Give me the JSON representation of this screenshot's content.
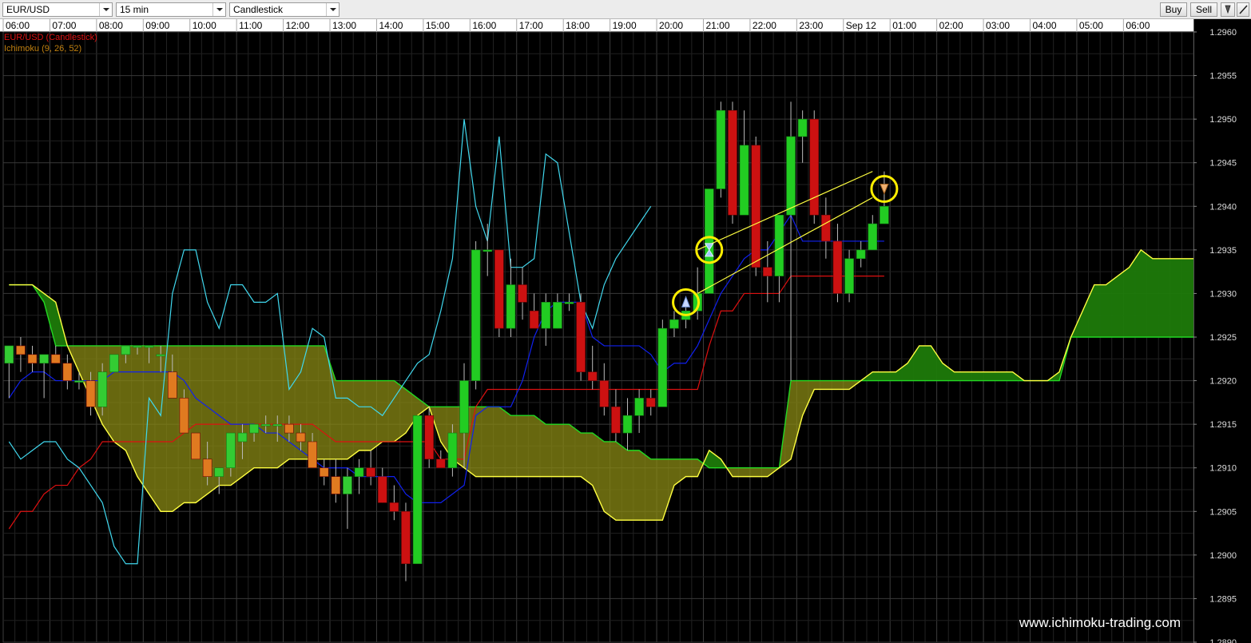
{
  "toolbar": {
    "symbol": "EUR/USD",
    "timeframe": "15 min",
    "chart_type": "Candlestick",
    "buy_label": "Buy",
    "sell_label": "Sell",
    "icon_arrow": "arrow-down-icon",
    "icon_pencil": "pencil-icon"
  },
  "legend": {
    "series": "EUR/USD (Candlestick)",
    "indicator": "Ichimoku (9, 26, 52)"
  },
  "watermark": "www.ichimoku-trading.com",
  "colors": {
    "background": "#000000",
    "grid": "#2c2c2c",
    "candle_up": "#22cc22",
    "candle_down": "#cc1111",
    "candle_up_cloud": "#33cc33",
    "candle_down_cloud": "#e07a20",
    "tenkan": "#1020ee",
    "kijun": "#dd1010",
    "chikou": "#40d8ee",
    "senkou_a": "#ffff40",
    "senkou_b": "#22d822",
    "cloud_bull": "#1d7a0a",
    "cloud_bear": "#8a8a14",
    "channel": "#ffff40",
    "signal_circle": "#ffee00",
    "label_series": "#dd1111",
    "label_indicator": "#c08010"
  },
  "chart_data": {
    "type": "candlestick",
    "interval": "15 min",
    "ylim": [
      1.289,
      1.296
    ],
    "y_ticks": [
      "1.2890",
      "1.2895",
      "1.2900",
      "1.2905",
      "1.2910",
      "1.2915",
      "1.2920",
      "1.2925",
      "1.2930",
      "1.2935",
      "1.2940",
      "1.2945",
      "1.2950",
      "1.2955",
      "1.2960"
    ],
    "x_ticks": [
      "06:00",
      "07:00",
      "08:00",
      "09:00",
      "10:00",
      "11:00",
      "12:00",
      "13:00",
      "14:00",
      "15:00",
      "16:00",
      "17:00",
      "18:00",
      "19:00",
      "20:00",
      "21:00",
      "22:00",
      "23:00",
      "Sep 12",
      "01:00",
      "02:00",
      "03:00",
      "04:00",
      "05:00",
      "06:00"
    ],
    "candles": [
      {
        "t": "06:00",
        "o": 1.2922,
        "h": 1.2924,
        "l": 1.2918,
        "c": 1.2924
      },
      {
        "t": "06:15",
        "o": 1.2924,
        "h": 1.2925,
        "l": 1.2921,
        "c": 1.2923
      },
      {
        "t": "06:30",
        "o": 1.2923,
        "h": 1.2924,
        "l": 1.2921,
        "c": 1.2922
      },
      {
        "t": "06:45",
        "o": 1.2922,
        "h": 1.2923,
        "l": 1.2918,
        "c": 1.2923
      },
      {
        "t": "07:00",
        "o": 1.2923,
        "h": 1.2924,
        "l": 1.2922,
        "c": 1.2922
      },
      {
        "t": "07:15",
        "o": 1.2922,
        "h": 1.2923,
        "l": 1.2919,
        "c": 1.292
      },
      {
        "t": "07:30",
        "o": 1.292,
        "h": 1.2921,
        "l": 1.2919,
        "c": 1.292
      },
      {
        "t": "07:45",
        "o": 1.292,
        "h": 1.2921,
        "l": 1.2916,
        "c": 1.2917
      },
      {
        "t": "08:00",
        "o": 1.2917,
        "h": 1.2922,
        "l": 1.2916,
        "c": 1.2921
      },
      {
        "t": "08:15",
        "o": 1.2921,
        "h": 1.2923,
        "l": 1.2921,
        "c": 1.2923
      },
      {
        "t": "08:30",
        "o": 1.2923,
        "h": 1.2924,
        "l": 1.2922,
        "c": 1.2924
      },
      {
        "t": "08:45",
        "o": 1.2924,
        "h": 1.2924,
        "l": 1.2923,
        "c": 1.2924
      },
      {
        "t": "09:00",
        "o": 1.2924,
        "h": 1.2924,
        "l": 1.2922,
        "c": 1.2924
      },
      {
        "t": "09:15",
        "o": 1.2923,
        "h": 1.2924,
        "l": 1.2921,
        "c": 1.2923
      },
      {
        "t": "09:30",
        "o": 1.2921,
        "h": 1.2923,
        "l": 1.2918,
        "c": 1.2918
      },
      {
        "t": "09:45",
        "o": 1.2918,
        "h": 1.2919,
        "l": 1.2914,
        "c": 1.2914
      },
      {
        "t": "10:00",
        "o": 1.2914,
        "h": 1.2914,
        "l": 1.2911,
        "c": 1.2911
      },
      {
        "t": "10:15",
        "o": 1.2911,
        "h": 1.2913,
        "l": 1.2908,
        "c": 1.2909
      },
      {
        "t": "10:30",
        "o": 1.2909,
        "h": 1.291,
        "l": 1.2907,
        "c": 1.291
      },
      {
        "t": "10:45",
        "o": 1.291,
        "h": 1.2914,
        "l": 1.2909,
        "c": 1.2914
      },
      {
        "t": "11:00",
        "o": 1.2913,
        "h": 1.2915,
        "l": 1.2911,
        "c": 1.2914
      },
      {
        "t": "11:15",
        "o": 1.2914,
        "h": 1.2915,
        "l": 1.2913,
        "c": 1.2915
      },
      {
        "t": "11:30",
        "o": 1.2915,
        "h": 1.2916,
        "l": 1.2914,
        "c": 1.2915
      },
      {
        "t": "11:45",
        "o": 1.2915,
        "h": 1.2916,
        "l": 1.2913,
        "c": 1.2915
      },
      {
        "t": "12:00",
        "o": 1.2915,
        "h": 1.2916,
        "l": 1.2913,
        "c": 1.2914
      },
      {
        "t": "12:15",
        "o": 1.2914,
        "h": 1.2915,
        "l": 1.2912,
        "c": 1.2913
      },
      {
        "t": "12:30",
        "o": 1.2913,
        "h": 1.2914,
        "l": 1.291,
        "c": 1.291
      },
      {
        "t": "12:45",
        "o": 1.291,
        "h": 1.2911,
        "l": 1.2908,
        "c": 1.2909
      },
      {
        "t": "13:00",
        "o": 1.2909,
        "h": 1.2911,
        "l": 1.2906,
        "c": 1.2907
      },
      {
        "t": "13:15",
        "o": 1.2907,
        "h": 1.291,
        "l": 1.2903,
        "c": 1.2909
      },
      {
        "t": "13:30",
        "o": 1.2909,
        "h": 1.2911,
        "l": 1.2907,
        "c": 1.291
      },
      {
        "t": "13:45",
        "o": 1.291,
        "h": 1.2912,
        "l": 1.2908,
        "c": 1.2909
      },
      {
        "t": "14:00",
        "o": 1.2909,
        "h": 1.291,
        "l": 1.2906,
        "c": 1.2906
      },
      {
        "t": "14:15",
        "o": 1.2906,
        "h": 1.2908,
        "l": 1.2904,
        "c": 1.2905
      },
      {
        "t": "14:30",
        "o": 1.2905,
        "h": 1.2906,
        "l": 1.2897,
        "c": 1.2899
      },
      {
        "t": "14:45",
        "o": 1.2899,
        "h": 1.2916,
        "l": 1.2899,
        "c": 1.2916
      },
      {
        "t": "15:00",
        "o": 1.2916,
        "h": 1.2917,
        "l": 1.291,
        "c": 1.2911
      },
      {
        "t": "15:15",
        "o": 1.2911,
        "h": 1.2912,
        "l": 1.291,
        "c": 1.291
      },
      {
        "t": "15:30",
        "o": 1.291,
        "h": 1.2915,
        "l": 1.2909,
        "c": 1.2914
      },
      {
        "t": "15:45",
        "o": 1.2914,
        "h": 1.2922,
        "l": 1.291,
        "c": 1.292
      },
      {
        "t": "16:00",
        "o": 1.292,
        "h": 1.2936,
        "l": 1.2919,
        "c": 1.2935
      },
      {
        "t": "16:15",
        "o": 1.2935,
        "h": 1.2938,
        "l": 1.2932,
        "c": 1.2935
      },
      {
        "t": "16:30",
        "o": 1.2935,
        "h": 1.2935,
        "l": 1.2925,
        "c": 1.2926
      },
      {
        "t": "16:45",
        "o": 1.2926,
        "h": 1.2934,
        "l": 1.2925,
        "c": 1.2931
      },
      {
        "t": "17:00",
        "o": 1.2931,
        "h": 1.2933,
        "l": 1.2927,
        "c": 1.2929
      },
      {
        "t": "17:15",
        "o": 1.2928,
        "h": 1.293,
        "l": 1.2927,
        "c": 1.2926
      },
      {
        "t": "17:30",
        "o": 1.2926,
        "h": 1.293,
        "l": 1.2924,
        "c": 1.2929
      },
      {
        "t": "17:45",
        "o": 1.2926,
        "h": 1.293,
        "l": 1.2926,
        "c": 1.2929
      },
      {
        "t": "18:00",
        "o": 1.2929,
        "h": 1.293,
        "l": 1.2928,
        "c": 1.2929
      },
      {
        "t": "18:15",
        "o": 1.2929,
        "h": 1.293,
        "l": 1.292,
        "c": 1.2921
      },
      {
        "t": "18:30",
        "o": 1.2921,
        "h": 1.2924,
        "l": 1.2919,
        "c": 1.292
      },
      {
        "t": "18:45",
        "o": 1.292,
        "h": 1.2922,
        "l": 1.2916,
        "c": 1.2917
      },
      {
        "t": "19:00",
        "o": 1.2917,
        "h": 1.2919,
        "l": 1.2913,
        "c": 1.2914
      },
      {
        "t": "19:15",
        "o": 1.2914,
        "h": 1.2918,
        "l": 1.2912,
        "c": 1.2916
      },
      {
        "t": "19:30",
        "o": 1.2916,
        "h": 1.2919,
        "l": 1.2914,
        "c": 1.2918
      },
      {
        "t": "19:45",
        "o": 1.2918,
        "h": 1.2919,
        "l": 1.2916,
        "c": 1.2917
      },
      {
        "t": "20:00",
        "o": 1.2917,
        "h": 1.2927,
        "l": 1.2917,
        "c": 1.2926
      },
      {
        "t": "20:15",
        "o": 1.2926,
        "h": 1.2928,
        "l": 1.2925,
        "c": 1.2927
      },
      {
        "t": "20:30",
        "o": 1.2927,
        "h": 1.2929,
        "l": 1.2926,
        "c": 1.2928
      },
      {
        "t": "20:45",
        "o": 1.2928,
        "h": 1.2933,
        "l": 1.2927,
        "c": 1.293
      },
      {
        "t": "21:00",
        "o": 1.293,
        "h": 1.2942,
        "l": 1.293,
        "c": 1.2942
      },
      {
        "t": "21:15",
        "o": 1.2942,
        "h": 1.2952,
        "l": 1.2941,
        "c": 1.2951
      },
      {
        "t": "21:30",
        "o": 1.2951,
        "h": 1.2952,
        "l": 1.2938,
        "c": 1.2939
      },
      {
        "t": "21:45",
        "o": 1.2939,
        "h": 1.2951,
        "l": 1.2939,
        "c": 1.2947
      },
      {
        "t": "22:00",
        "o": 1.2947,
        "h": 1.2948,
        "l": 1.2932,
        "c": 1.2933
      },
      {
        "t": "22:15",
        "o": 1.2933,
        "h": 1.2936,
        "l": 1.2929,
        "c": 1.2932
      },
      {
        "t": "22:30",
        "o": 1.2932,
        "h": 1.2938,
        "l": 1.2929,
        "c": 1.2939
      },
      {
        "t": "22:45",
        "o": 1.2939,
        "h": 1.2952,
        "l": 1.292,
        "c": 1.2948
      },
      {
        "t": "23:00",
        "o": 1.2948,
        "h": 1.2951,
        "l": 1.2945,
        "c": 1.295
      },
      {
        "t": "23:15",
        "o": 1.295,
        "h": 1.2951,
        "l": 1.2938,
        "c": 1.2939
      },
      {
        "t": "23:30",
        "o": 1.2939,
        "h": 1.2941,
        "l": 1.2934,
        "c": 1.2936
      },
      {
        "t": "23:45",
        "o": 1.2936,
        "h": 1.2938,
        "l": 1.2929,
        "c": 1.293
      },
      {
        "t": "Sep 12 00:00",
        "o": 1.293,
        "h": 1.2935,
        "l": 1.2929,
        "c": 1.2934
      },
      {
        "t": "00:15",
        "o": 1.2934,
        "h": 1.2936,
        "l": 1.2933,
        "c": 1.2935
      },
      {
        "t": "00:30",
        "o": 1.2935,
        "h": 1.2939,
        "l": 1.2935,
        "c": 1.2938
      },
      {
        "t": "00:45",
        "o": 1.2938,
        "h": 1.2944,
        "l": 1.2938,
        "c": 1.294
      }
    ],
    "tenkan": [
      1.2918,
      1.292,
      1.2921,
      1.2921,
      1.292,
      1.292,
      1.292,
      1.292,
      1.292,
      1.2921,
      1.2921,
      1.2921,
      1.2921,
      1.2921,
      1.2921,
      1.292,
      1.2918,
      1.2917,
      1.2916,
      1.2915,
      1.2915,
      1.2915,
      1.2914,
      1.2914,
      1.2913,
      1.2912,
      1.2911,
      1.291,
      1.291,
      1.291,
      1.2909,
      1.2909,
      1.2909,
      1.2909,
      1.2907,
      1.2906,
      1.2906,
      1.2906,
      1.2907,
      1.2908,
      1.2916,
      1.2917,
      1.2917,
      1.2917,
      1.292,
      1.2925,
      1.2928,
      1.2929,
      1.2929,
      1.2929,
      1.2925,
      1.2924,
      1.2924,
      1.2924,
      1.2924,
      1.2923,
      1.2921,
      1.2922,
      1.2922,
      1.2924,
      1.2927,
      1.293,
      1.2932,
      1.2934,
      1.2935,
      1.2935,
      1.2937,
      1.2939,
      1.2936,
      1.2936,
      1.2936,
      1.2936,
      1.2936,
      1.2936,
      1.2936,
      1.2936
    ],
    "kijun": [
      1.2903,
      1.2905,
      1.2905,
      1.2907,
      1.2908,
      1.2908,
      1.291,
      1.2911,
      1.2913,
      1.2913,
      1.2913,
      1.2913,
      1.2913,
      1.2913,
      1.2913,
      1.2914,
      1.2915,
      1.2915,
      1.2915,
      1.2915,
      1.2915,
      1.2915,
      1.2915,
      1.2915,
      1.2915,
      1.2915,
      1.2915,
      1.2914,
      1.2913,
      1.2913,
      1.2913,
      1.2913,
      1.2913,
      1.2913,
      1.2913,
      1.2913,
      1.2913,
      1.2911,
      1.2911,
      1.2911,
      1.2917,
      1.2919,
      1.2919,
      1.2919,
      1.2919,
      1.2919,
      1.2919,
      1.2919,
      1.2919,
      1.2919,
      1.2919,
      1.2919,
      1.2919,
      1.2919,
      1.2919,
      1.2919,
      1.2919,
      1.2919,
      1.2919,
      1.2919,
      1.2924,
      1.2928,
      1.2928,
      1.293,
      1.293,
      1.293,
      1.293,
      1.2932,
      1.2932,
      1.2932,
      1.2932,
      1.2932,
      1.2932,
      1.2932,
      1.2932,
      1.2932
    ],
    "chikou_series": [
      1.2913,
      1.2911,
      1.2912,
      1.2913,
      1.2913,
      1.2911,
      1.291,
      1.2908,
      1.2906,
      1.2901,
      1.2899,
      1.2899,
      1.2918,
      1.2916,
      1.293,
      1.2935,
      1.2935,
      1.2929,
      1.2926,
      1.2931,
      1.2931,
      1.2929,
      1.2929,
      1.293,
      1.2919,
      1.2921,
      1.2926,
      1.2925,
      1.2918,
      1.2918,
      1.2917,
      1.2917,
      1.2916,
      1.2918,
      1.292,
      1.2922,
      1.2923,
      1.2928,
      1.2934,
      1.295,
      1.294,
      1.2936,
      1.2948,
      1.2933,
      1.2933,
      1.2934,
      1.2946,
      1.2945,
      1.2937,
      1.2929,
      1.2926,
      1.2931,
      1.2934,
      1.2936,
      1.2938,
      1.294
    ],
    "senkou_a": [
      1.2931,
      1.2931,
      1.2931,
      1.293,
      1.2929,
      1.2924,
      1.2921,
      1.2918,
      1.2915,
      1.2913,
      1.2912,
      1.2909,
      1.2907,
      1.2905,
      1.2905,
      1.2906,
      1.2906,
      1.2907,
      1.2908,
      1.2908,
      1.2909,
      1.291,
      1.291,
      1.291,
      1.2911,
      1.2911,
      1.2911,
      1.2911,
      1.2911,
      1.2911,
      1.2912,
      1.2912,
      1.2913,
      1.2913,
      1.2914,
      1.2916,
      1.2917,
      1.2913,
      1.2911,
      1.291,
      1.2909,
      1.2909,
      1.2909,
      1.2909,
      1.2909,
      1.2909,
      1.2909,
      1.2909,
      1.2909,
      1.2909,
      1.2908,
      1.2905,
      1.2904,
      1.2904,
      1.2904,
      1.2904,
      1.2904,
      1.2908,
      1.2909,
      1.2909,
      1.2912,
      1.2911,
      1.2909,
      1.2909,
      1.2909,
      1.2909,
      1.291,
      1.2911,
      1.2916,
      1.2919,
      1.2919,
      1.2919,
      1.2919,
      1.292,
      1.2921,
      1.2921,
      1.2921,
      1.2922,
      1.2924,
      1.2924,
      1.2922,
      1.2921,
      1.2921,
      1.2921,
      1.2921,
      1.2921,
      1.2921,
      1.292,
      1.292,
      1.292,
      1.2921,
      1.2925,
      1.2928,
      1.2931,
      1.2931,
      1.2932,
      1.2933,
      1.2935,
      1.2934,
      1.2934,
      1.2934,
      1.2934,
      1.2934,
      1.2934,
      1.2934,
      1.2934,
      1.2934,
      1.2934,
      1.2934,
      1.2934,
      1.2934,
      1.2934
    ],
    "senkou_b": [
      1.2931,
      1.2931,
      1.2931,
      1.2929,
      1.2924,
      1.2924,
      1.2924,
      1.2924,
      1.2924,
      1.2924,
      1.2924,
      1.2924,
      1.2924,
      1.2924,
      1.2924,
      1.2924,
      1.2924,
      1.2924,
      1.2924,
      1.2924,
      1.2924,
      1.2924,
      1.2924,
      1.2924,
      1.2924,
      1.2924,
      1.2924,
      1.2924,
      1.292,
      1.292,
      1.292,
      1.292,
      1.292,
      1.292,
      1.2919,
      1.2918,
      1.2917,
      1.2917,
      1.2917,
      1.2917,
      1.2917,
      1.2917,
      1.2917,
      1.2916,
      1.2916,
      1.2916,
      1.2915,
      1.2915,
      1.2915,
      1.2914,
      1.2914,
      1.2913,
      1.2913,
      1.2912,
      1.2912,
      1.2911,
      1.2911,
      1.2911,
      1.2911,
      1.2911,
      1.291,
      1.291,
      1.291,
      1.291,
      1.291,
      1.291,
      1.291,
      1.292,
      1.292,
      1.292,
      1.292,
      1.292,
      1.292,
      1.292,
      1.292,
      1.292,
      1.292,
      1.292,
      1.292,
      1.292,
      1.292,
      1.292,
      1.292,
      1.292,
      1.292,
      1.292,
      1.292,
      1.292,
      1.292,
      1.292,
      1.292,
      1.2925,
      1.2925,
      1.2925,
      1.2925,
      1.2925,
      1.2925,
      1.2925,
      1.2925,
      1.2925,
      1.2925,
      1.2925,
      1.2925,
      1.2925,
      1.2925,
      1.2925,
      1.2925,
      1.2925,
      1.2925,
      1.2925,
      1.2925,
      1.2925
    ],
    "channel_lines": [
      {
        "from": {
          "t": "20:45",
          "y": 1.2935
        },
        "to": {
          "t": "00:30",
          "y": 1.2944
        }
      },
      {
        "from": {
          "t": "20:45",
          "y": 1.293
        },
        "to": {
          "t": "00:30",
          "y": 1.2941
        }
      }
    ],
    "signals": [
      {
        "t": "20:30",
        "price": 1.2929,
        "kind": "up-arrow"
      },
      {
        "t": "21:00",
        "price": 1.2935,
        "kind": "hourglass"
      },
      {
        "t": "00:45",
        "price": 1.2942,
        "kind": "down-arrow"
      }
    ]
  }
}
